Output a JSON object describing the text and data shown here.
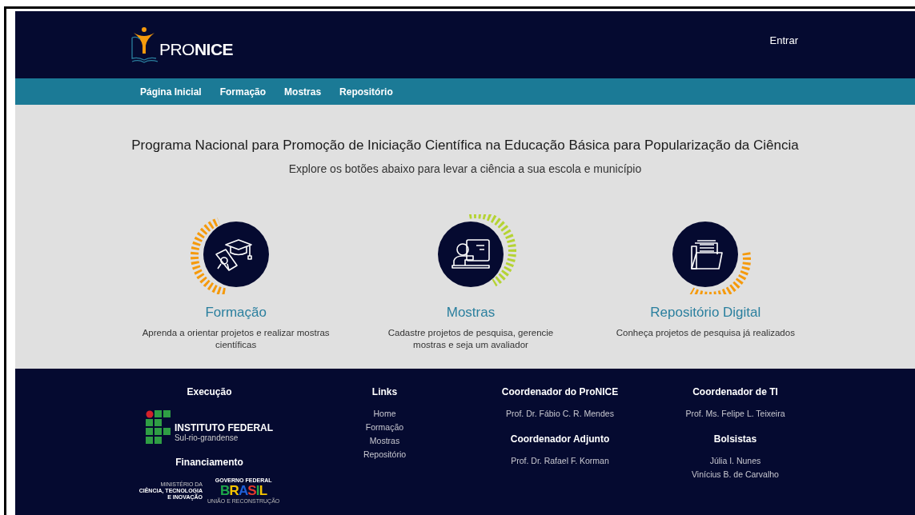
{
  "header": {
    "logo": "PRO**NICE**",
    "login": "Entrar"
  },
  "nav": [
    "Página Inicial",
    "Formação",
    "Mostras",
    "Repositório"
  ],
  "hero": {
    "title": "Programa Nacional para Promoção de Iniciação Científica na Educação Básica para Popularização da Ciência",
    "subtitle": "Explore os botões abaixo para levar a ciência a sua escola e município"
  },
  "cards": [
    {
      "kind": "graduation",
      "color": "#f59a0c",
      "title": "Formação",
      "description": "Aprenda a orientar projetos e realizar mostras científicas"
    },
    {
      "kind": "presenter",
      "color": "#b5d334",
      "title": "Mostras",
      "description": "Cadastre projetos de pesquisa, gerencie mostras e seja um avaliador"
    },
    {
      "kind": "folder",
      "color": "#f59a0c",
      "title": "Repositório Digital",
      "description": "Conheça projetos de pesquisa já realizados"
    }
  ],
  "footer": {
    "execution": {
      "heading": "Execução",
      "institute": "INSTITUTO FEDERAL",
      "campus": "Sul-rio-grandense"
    },
    "funding": {
      "heading": "Financiamento",
      "ministry": [
        "MINISTÉRIO DA",
        "CIÊNCIA, TECNOLOGIA",
        "E INOVAÇÃO"
      ],
      "government": "GOVERNO FEDERAL",
      "country": "BRASIL",
      "motto": "UNIÃO E RECONSTRUÇÃO"
    },
    "links": {
      "heading": "Links",
      "items": [
        "Home",
        "Formação",
        "Mostras",
        "Repositório"
      ]
    },
    "staff_columns": [
      [
        {
          "heading": "Coordenador do ProNICE",
          "names": [
            "Prof. Dr. Fábio C. R. Mendes"
          ]
        },
        {
          "heading": "Coordenador Adjunto",
          "names": [
            "Prof. Dr. Rafael F. Korman"
          ]
        }
      ],
      [
        {
          "heading": "Coordenador de TI",
          "names": [
            "Prof. Ms. Felipe L. Teixeira"
          ]
        },
        {
          "heading": "Bolsistas",
          "names": [
            "Júlia I. Nunes",
            "Vinícius B. de Carvalho"
          ]
        }
      ]
    ]
  }
}
